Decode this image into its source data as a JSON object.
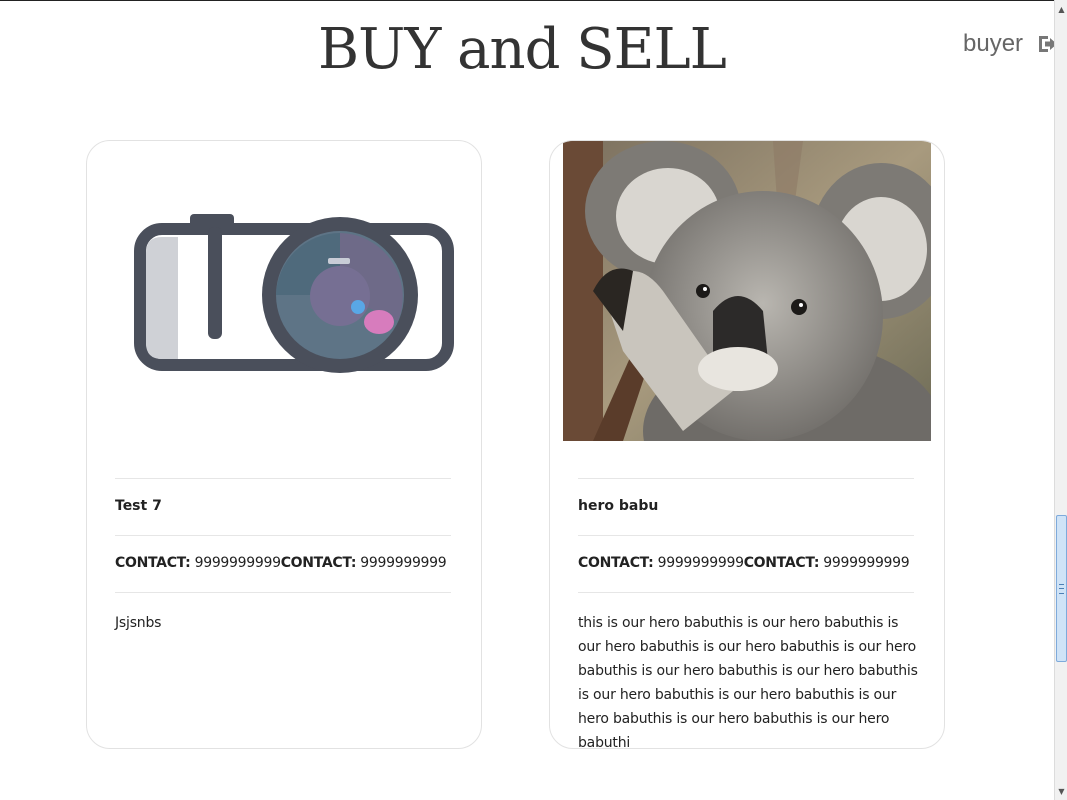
{
  "header": {
    "title": "BUY and SELL",
    "username": "buyer",
    "logout_icon": "sign-out-icon"
  },
  "cards": [
    {
      "image_icon": "camera-icon",
      "name": "Test 7",
      "contact_label_1": "CONTACT:",
      "contact_value_1": "9999999999",
      "contact_label_2": "CONTACT:",
      "contact_value_2": "9999999999",
      "description": "Jsjsnbs"
    },
    {
      "image_icon": "koala-photo",
      "name": "hero babu",
      "contact_label_1": "CONTACT:",
      "contact_value_1": "9999999999",
      "contact_label_2": "CONTACT:",
      "contact_value_2": "9999999999",
      "description": "this is our hero babuthis is our hero babuthis is our hero babuthis is our hero babuthis is our hero babuthis is our hero babuthis is our hero babuthis is our hero babuthis is our hero babuthis is our hero babuthis is our hero babuthis is our hero babuthi"
    }
  ],
  "colors": {
    "title": "#333333",
    "username": "#666666",
    "card_border": "#e2e2e2",
    "scroll_thumb": "#cfe3f7"
  }
}
